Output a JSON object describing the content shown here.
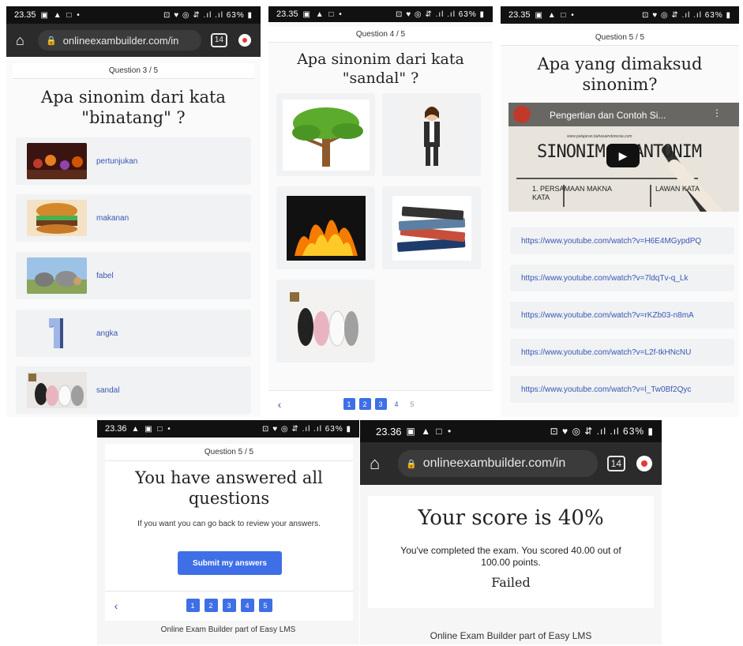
{
  "screen1": {
    "status": {
      "time": "23.35",
      "icons": "▣ ▲ □ •",
      "right": "⊡ ♥ ◎ ⇵ .ıl .ıl 63% ▮"
    },
    "url": {
      "host": "onlineexambuilder.com/in",
      "tabs": "14"
    },
    "question_header": "Question 3 / 5",
    "question": "Apa sinonim dari kata \"binatang\" ?",
    "options": [
      {
        "label": "pertunjukan",
        "icon": "performance-image"
      },
      {
        "label": "makanan",
        "icon": "burger-image"
      },
      {
        "label": "fabel",
        "icon": "animals-image"
      },
      {
        "label": "angka",
        "icon": "number-one-image"
      },
      {
        "label": "sandal",
        "icon": "sandals-image"
      }
    ]
  },
  "screen2": {
    "status": {
      "time": "23.35",
      "icons": "▣ ▲ □ •",
      "right": "⊡ ♥ ◎ ⇵ .ıl .ıl 63% ▮"
    },
    "question_header": "Question 4 / 5",
    "question": "Apa sinonim dari kata \"sandal\" ?",
    "tiles": [
      "tree-image",
      "teacher-image",
      "fire-image",
      "books-image",
      "sandals-image"
    ],
    "pages": [
      "1",
      "2",
      "3",
      "4",
      "5"
    ],
    "back": "‹"
  },
  "screen3": {
    "status": {
      "time": "23.35",
      "icons": "▣ ▲ □ •",
      "right": "⊡ ♥ ◎ ⇵ .ıl .ıl 63% ▮"
    },
    "question_header": "Question 5 / 5",
    "question": "Apa yang dimaksud sinonim?",
    "video": {
      "title": "Pengertian dan Contoh Si...",
      "board_text": "SINONIM & ANTONIM",
      "line1": "1. PERSAMAAN MAKNA KATA",
      "line2": "LAWAN KATA",
      "url_small": "www.pelajaran.bahasaindonesia.com"
    },
    "links": [
      "https://www.youtube.com/watch?v=H6E4MGypdPQ",
      "https://www.youtube.com/watch?v=7ldqTv-q_Lk",
      "https://www.youtube.com/watch?v=rKZb03-n8mA",
      "https://www.youtube.com/watch?v=L2f-tkHNcNU",
      "https://www.youtube.com/watch?v=l_Tw0Bf2Qyc"
    ]
  },
  "screen4": {
    "status": {
      "time": "23.36",
      "icons": "▲ ▣ □ •",
      "right": "⊡ ♥ ◎ ⇵ .ıl .ıl 63% ▮"
    },
    "question_header": "Question 5 / 5",
    "title": "You have answered all questions",
    "subtitle": "If you want you can go back to review your answers.",
    "submit_label": "Submit my answers",
    "pages": [
      "1",
      "2",
      "3",
      "4",
      "5"
    ],
    "back": "‹",
    "footer": "Online Exam Builder part of Easy LMS"
  },
  "screen5": {
    "status": {
      "time": "23.36",
      "icons": "▣ ▲ □ •",
      "right": "⊡ ♥ ◎ ⇵ .ıl .ıl 63% ▮"
    },
    "url": {
      "host": "onlineexambuilder.com/in",
      "tabs": "14"
    },
    "score_title": "Your score is 40%",
    "score_text": "You've completed the exam. You scored 40.00 out of 100.00 points.",
    "result": "Failed",
    "footer": "Online Exam Builder part of Easy LMS"
  }
}
